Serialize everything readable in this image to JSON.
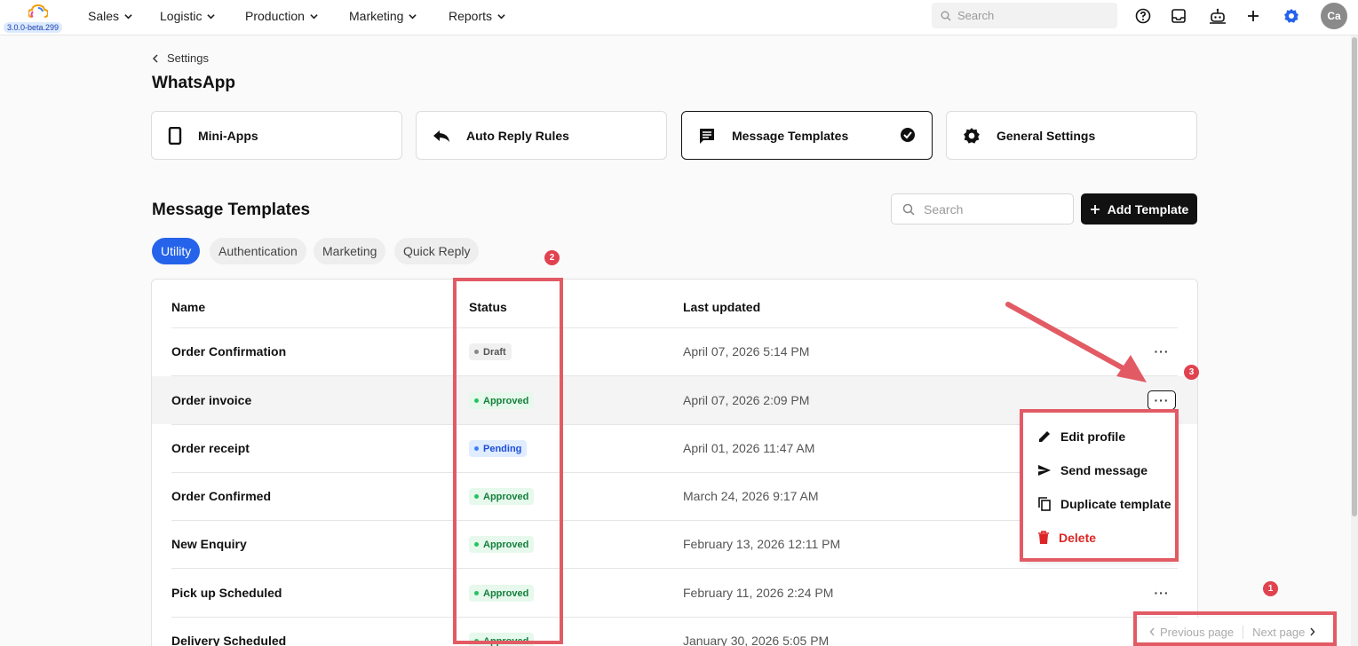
{
  "app": {
    "version": "3.0.0-beta.299"
  },
  "topnav": {
    "items": [
      {
        "label": "Sales"
      },
      {
        "label": "Logistic"
      },
      {
        "label": "Production"
      },
      {
        "label": "Marketing"
      },
      {
        "label": "Reports"
      }
    ],
    "search_placeholder": "Search",
    "icons": [
      "help-icon",
      "inbox-icon",
      "bot-icon",
      "plus-icon",
      "gear-icon"
    ],
    "avatar_initials": "Ca",
    "accent": "#2563eb"
  },
  "breadcrumb": {
    "back_label": "Settings"
  },
  "page": {
    "title": "WhatsApp"
  },
  "cards": [
    {
      "label": "Mini-Apps",
      "icon": "phone-icon"
    },
    {
      "label": "Auto Reply Rules",
      "icon": "reply-icon"
    },
    {
      "label": "Message Templates",
      "icon": "message-icon",
      "selected": true
    },
    {
      "label": "General Settings",
      "icon": "gear-icon"
    }
  ],
  "section": {
    "title": "Message Templates",
    "search_placeholder": "Search",
    "add_label": "Add Template"
  },
  "tabs": [
    {
      "label": "Utility",
      "active": true
    },
    {
      "label": "Authentication"
    },
    {
      "label": "Marketing"
    },
    {
      "label": "Quick Reply"
    }
  ],
  "table": {
    "headers": {
      "name": "Name",
      "status": "Status",
      "updated": "Last updated"
    },
    "rows": [
      {
        "name": "Order Confirmation",
        "status": "Draft",
        "updated": "April 07, 2026 5:14 PM"
      },
      {
        "name": "Order invoice",
        "status": "Approved",
        "updated": "April 07, 2026 2:09 PM"
      },
      {
        "name": "Order receipt",
        "status": "Pending",
        "updated": "April 01, 2026 11:47 AM"
      },
      {
        "name": "Order Confirmed",
        "status": "Approved",
        "updated": "March 24, 2026 9:17 AM"
      },
      {
        "name": "New Enquiry",
        "status": "Approved",
        "updated": "February 13, 2026 12:11 PM"
      },
      {
        "name": "Pick up Scheduled",
        "status": "Approved",
        "updated": "February 11, 2026 2:24 PM"
      },
      {
        "name": "Delivery Scheduled",
        "status": "Approved",
        "updated": "January 30, 2026 5:05 PM"
      }
    ],
    "more_label": "···"
  },
  "menu": {
    "items": [
      {
        "label": "Edit profile",
        "icon": "pencil-icon"
      },
      {
        "label": "Send message",
        "icon": "send-icon"
      },
      {
        "label": "Duplicate template",
        "icon": "copy-icon"
      },
      {
        "label": "Delete",
        "icon": "trash-icon",
        "danger": true
      }
    ]
  },
  "pager": {
    "prev_label": "Previous page",
    "next_label": "Next page"
  },
  "annotations": {
    "n1": "1",
    "n2": "2",
    "n3": "3",
    "color": "#e25b64"
  },
  "status_colors": {
    "Draft": {
      "bg": "#f0f0f0",
      "fg": "#555555",
      "dot": "#888888"
    },
    "Approved": {
      "bg": "#e7f8ec",
      "fg": "#15803d",
      "dot": "#22c55e"
    },
    "Pending": {
      "bg": "#e0ecff",
      "fg": "#1d4ed8",
      "dot": "#3b82f6"
    }
  }
}
